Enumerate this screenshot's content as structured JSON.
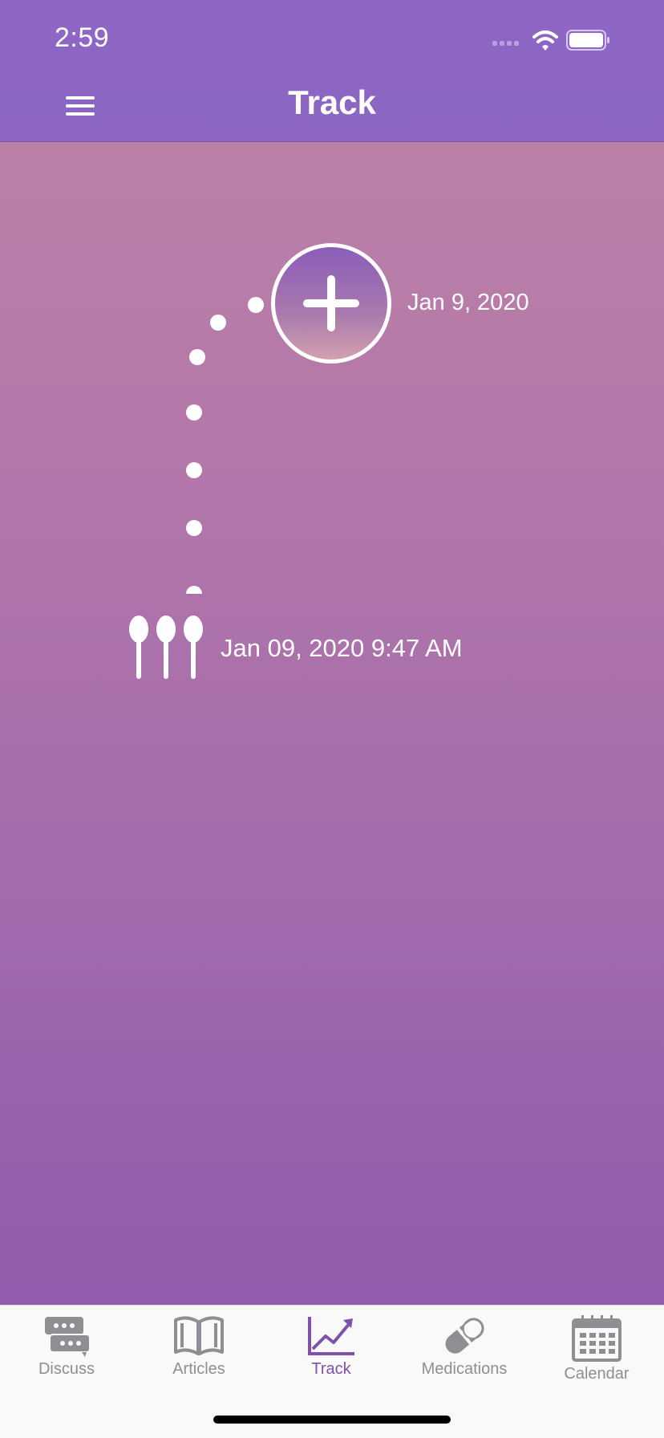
{
  "status_bar": {
    "time": "2:59"
  },
  "header": {
    "title": "Track",
    "menu_icon": "hamburger-menu-icon",
    "background": "#8c66c2"
  },
  "timeline": {
    "next_entry_date": "Jan 9, 2020",
    "add_icon": "plus-icon",
    "entries": [
      {
        "datetime": "Jan 09, 2020 9:47 AM",
        "icon": "spoons-icon",
        "spoon_count": 3
      }
    ]
  },
  "tab_bar": {
    "active_color": "#7d52a8",
    "inactive_color": "#8e8e93",
    "tabs": [
      {
        "label": "Discuss",
        "icon": "chat-bubbles-icon",
        "active": false
      },
      {
        "label": "Articles",
        "icon": "open-book-icon",
        "active": false
      },
      {
        "label": "Track",
        "icon": "trend-chart-icon",
        "active": true
      },
      {
        "label": "Medications",
        "icon": "pill-icon",
        "active": false
      },
      {
        "label": "Calendar",
        "icon": "calendar-icon",
        "active": false
      }
    ]
  }
}
